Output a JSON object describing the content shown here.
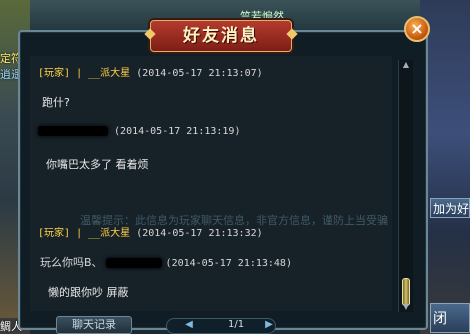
{
  "dialog": {
    "title": "好友消息"
  },
  "background": {
    "left_labels": [
      "定符",
      "逍遥",
      "鲷人"
    ],
    "top_label": "竺若煽然",
    "add_friend": "加为好",
    "close_side": "闭"
  },
  "messages": [
    {
      "tag": "[玩家]",
      "sender": "| __派大星",
      "time": "(2014-05-17 21:13:07)",
      "text": "跑什?"
    },
    {
      "tag": "",
      "sender": "",
      "time": "(2014-05-17 21:13:19)",
      "text": "你嘴巴太多了  看着烦"
    },
    {
      "tag": "[玩家]",
      "sender": "| __派大星",
      "time": "(2014-05-17 21:13:32)",
      "text": ""
    },
    {
      "tag": "",
      "sender": "",
      "prefix": "玩么你吗B、",
      "time": "(2014-05-17 21:13:48)",
      "text": "懒的跟你吵  屏蔽"
    }
  ],
  "watermark": "温馨提示：此信息为玩家聊天信息，非官方信息，谨防上当受骗",
  "footer": {
    "chat_record": "聊天记录",
    "page": "1/1"
  },
  "colors": {
    "title_red": "#b53a2e",
    "sender_yellow": "#ffd24a",
    "border": "#6b8795"
  },
  "icons": [
    "close-icon",
    "scroll-up-icon",
    "scroll-down-icon",
    "prev-page-icon",
    "next-page-icon"
  ]
}
